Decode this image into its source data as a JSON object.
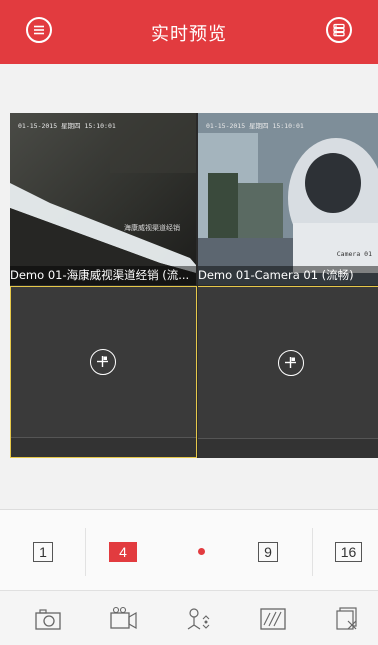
{
  "header": {
    "title": "实时预览",
    "menu_icon": "menu-icon",
    "layout_icon": "layout-list-icon",
    "accent_color": "#e23b3f"
  },
  "tiles": [
    {
      "caption": "Demo 01-海康威视渠道经销 (流...",
      "osd": "01-15-2015 星期四 15:10:01",
      "watermark": "海康威视渠道经销"
    },
    {
      "caption": "Demo 01-Camera 01 (流畅)",
      "osd": "01-15-2015 星期四 15:10:01",
      "camera_label": "Camera 01"
    },
    {
      "caption": "",
      "add_icon": "add-camera-icon"
    },
    {
      "caption": "",
      "add_icon": "add-camera-icon"
    }
  ],
  "split_options": [
    {
      "label": "1",
      "selected": false
    },
    {
      "label": "4",
      "selected": true
    },
    {
      "label": "9",
      "selected": false
    },
    {
      "label": "16",
      "selected": false
    }
  ],
  "toolbar": [
    {
      "icon": "camera-icon",
      "action": "capture"
    },
    {
      "icon": "record-icon",
      "action": "record"
    },
    {
      "icon": "ptz-icon",
      "action": "ptz"
    },
    {
      "icon": "quality-icon",
      "action": "quality"
    },
    {
      "icon": "close-all-icon",
      "action": "close-all"
    }
  ]
}
